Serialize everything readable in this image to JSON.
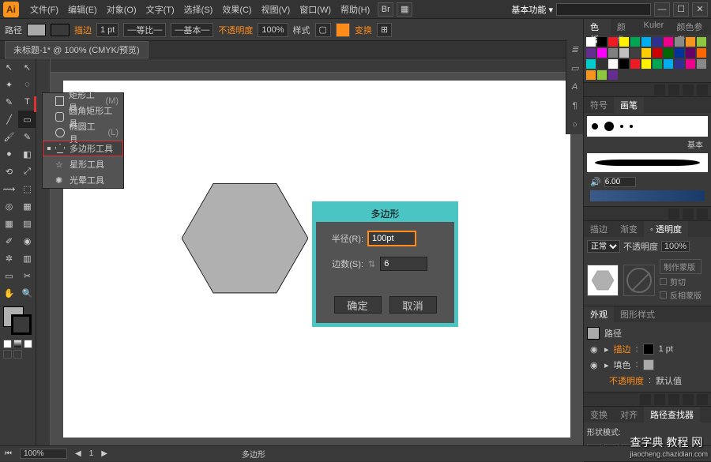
{
  "app_logo": "Ai",
  "menu": {
    "file": "文件(F)",
    "edit": "编辑(E)",
    "object": "对象(O)",
    "type": "文字(T)",
    "select": "选择(S)",
    "effect": "效果(C)",
    "view": "视图(V)",
    "window": "窗口(W)",
    "help": "帮助(H)"
  },
  "workspace": "基本功能",
  "options": {
    "path_label": "路径",
    "stroke_label": "描边",
    "stroke_width": "1 pt",
    "uniform": "等比",
    "profile": "基本",
    "opacity_label": "不透明度",
    "opacity_val": "100%",
    "style_label": "样式",
    "transform_label": "变换"
  },
  "doc_tab": "未标题-1* @ 100% (CMYK/预览)",
  "flyout": {
    "rect": "矩形工具",
    "rect_key": "(M)",
    "rrect": "圆角矩形工具",
    "ellipse": "椭圆工具",
    "ellipse_key": "(L)",
    "polygon": "多边形工具",
    "star": "星形工具",
    "flare": "光晕工具"
  },
  "dialog": {
    "title": "多边形",
    "radius_label": "半径(R):",
    "radius_val": "100pt",
    "sides_label": "边数(S):",
    "sides_val": "6",
    "ok": "确定",
    "cancel": "取消"
  },
  "panels": {
    "color_tab": "色板",
    "color2": "颜色",
    "kuler": "Kuler",
    "colorguide": "颜色参考",
    "brush_tab": "符号",
    "brush_tab2": "画笔",
    "brush_basic": "基本",
    "brush_size": "6.00",
    "stroke_tab": "描边",
    "grad_tab": "渐变",
    "trans_tab": "透明度",
    "blend_normal": "正常",
    "opacity_lbl": "不透明度",
    "opacity_100": "100%",
    "make_mask": "制作蒙版",
    "clip": "剪切",
    "invert": "反相蒙版",
    "appear_tab": "外观",
    "graphic_tab": "图形样式",
    "appear_path": "路径",
    "appear_stroke": "描边",
    "appear_stroke_val": "1 pt",
    "appear_fill": "填色",
    "appear_opacity": "不透明度",
    "appear_default": "默认值",
    "transform_tab": "变换",
    "align_tab": "对齐",
    "pathfinder_tab": "路径查找器",
    "shape_mode": "形状模式:"
  },
  "status": {
    "zoom": "100%",
    "tool": "多边形"
  },
  "watermark": {
    "main": "查字典 教程 网",
    "sub": "jiaocheng.chazidian.com"
  },
  "swatch_colors": [
    "#ffffff",
    "#000000",
    "#ed1c24",
    "#fff200",
    "#00a651",
    "#00aeef",
    "#2e3192",
    "#ec008c",
    "#898989",
    "#f7941d",
    "#8dc63f",
    "#662d91",
    "#ff00ff",
    "#808080",
    "#c0c0c0",
    "#404040",
    "#ffcc00",
    "#cc0000",
    "#006600",
    "#003399",
    "#660066",
    "#ff6600",
    "#00cccc",
    "#333333",
    "#ffffff",
    "#000000",
    "#ed1c24",
    "#fff200",
    "#00a651",
    "#00aeef",
    "#2e3192",
    "#ec008c",
    "#898989",
    "#f7941d",
    "#8dc63f",
    "#662d91"
  ]
}
